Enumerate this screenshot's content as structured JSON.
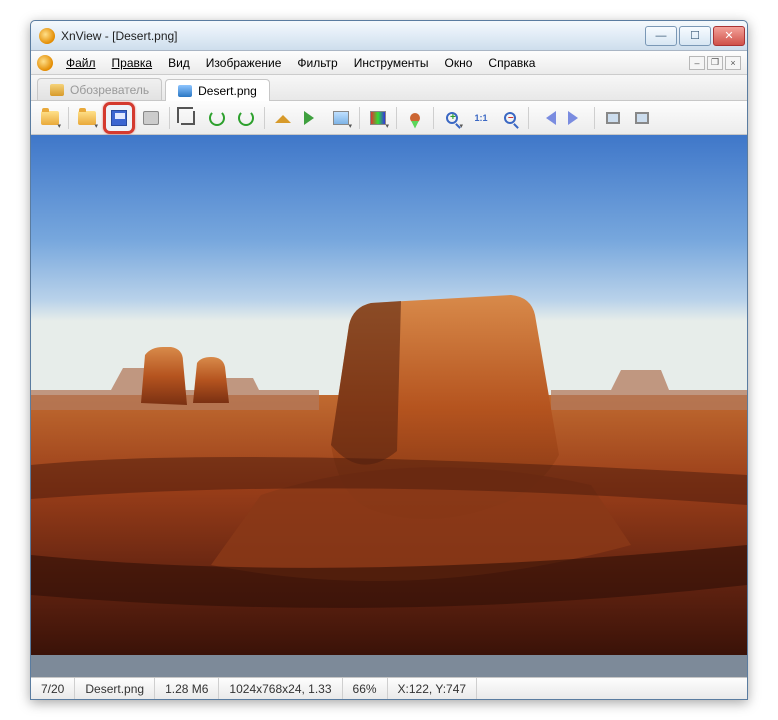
{
  "title": "XnView - [Desert.png]",
  "menu": {
    "file": "Файл",
    "edit": "Правка",
    "view": "Вид",
    "image": "Изображение",
    "filter": "Фильтр",
    "tools": "Инструменты",
    "window": "Окно",
    "help": "Справка"
  },
  "tabs": {
    "browser": "Обозреватель",
    "file": "Desert.png"
  },
  "toolbar": {
    "browse": "browse",
    "open": "open",
    "save": "save",
    "print": "print",
    "crop": "crop",
    "rotate_ccw": "rotate-ccw",
    "rotate_cw": "rotate-cw",
    "home": "home",
    "export": "export",
    "picture": "picture",
    "palette": "palette",
    "award": "award",
    "zoom_in": "zoom-in",
    "zoom_11": "1:1",
    "zoom_out": "zoom-out",
    "prev": "prev",
    "next": "next",
    "screen_l": "screen-l",
    "screen_r": "screen-r"
  },
  "status": {
    "index": "7/20",
    "filename": "Desert.png",
    "size": "1.28 M6",
    "dimensions": "1024x768x24, 1.33",
    "zoom": "66%",
    "coords": "X:122, Y:747"
  },
  "colors": {
    "highlight": "#d43a2f"
  }
}
